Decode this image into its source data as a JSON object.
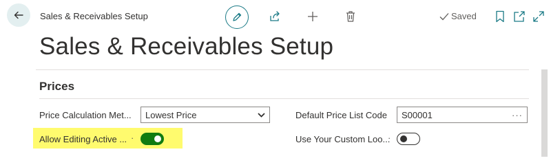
{
  "header": {
    "breadcrumb": "Sales & Receivables Setup",
    "saved_label": "Saved"
  },
  "page": {
    "title": "Sales & Receivables Setup"
  },
  "section": {
    "title": "Prices"
  },
  "fields": {
    "price_calc_label": "Price Calculation Met...",
    "price_calc_value": "Lowest Price",
    "default_price_list_label": "Default Price List Code",
    "default_price_list_value": "S00001",
    "allow_editing_label": "Allow Editing Active ...",
    "allow_editing_on": true,
    "custom_lookup_label": "Use Your Custom Loo...",
    "custom_lookup_on": false
  },
  "colors": {
    "accent": "#1a7a86",
    "toggle_on": "#107c10",
    "highlight": "#fffb6e"
  },
  "icons": [
    "back-arrow-icon",
    "pencil-icon",
    "share-icon",
    "plus-icon",
    "trash-icon",
    "check-icon",
    "bookmark-icon",
    "open-new-window-icon",
    "expand-icon",
    "chevron-down-icon",
    "ellipsis-icon"
  ]
}
